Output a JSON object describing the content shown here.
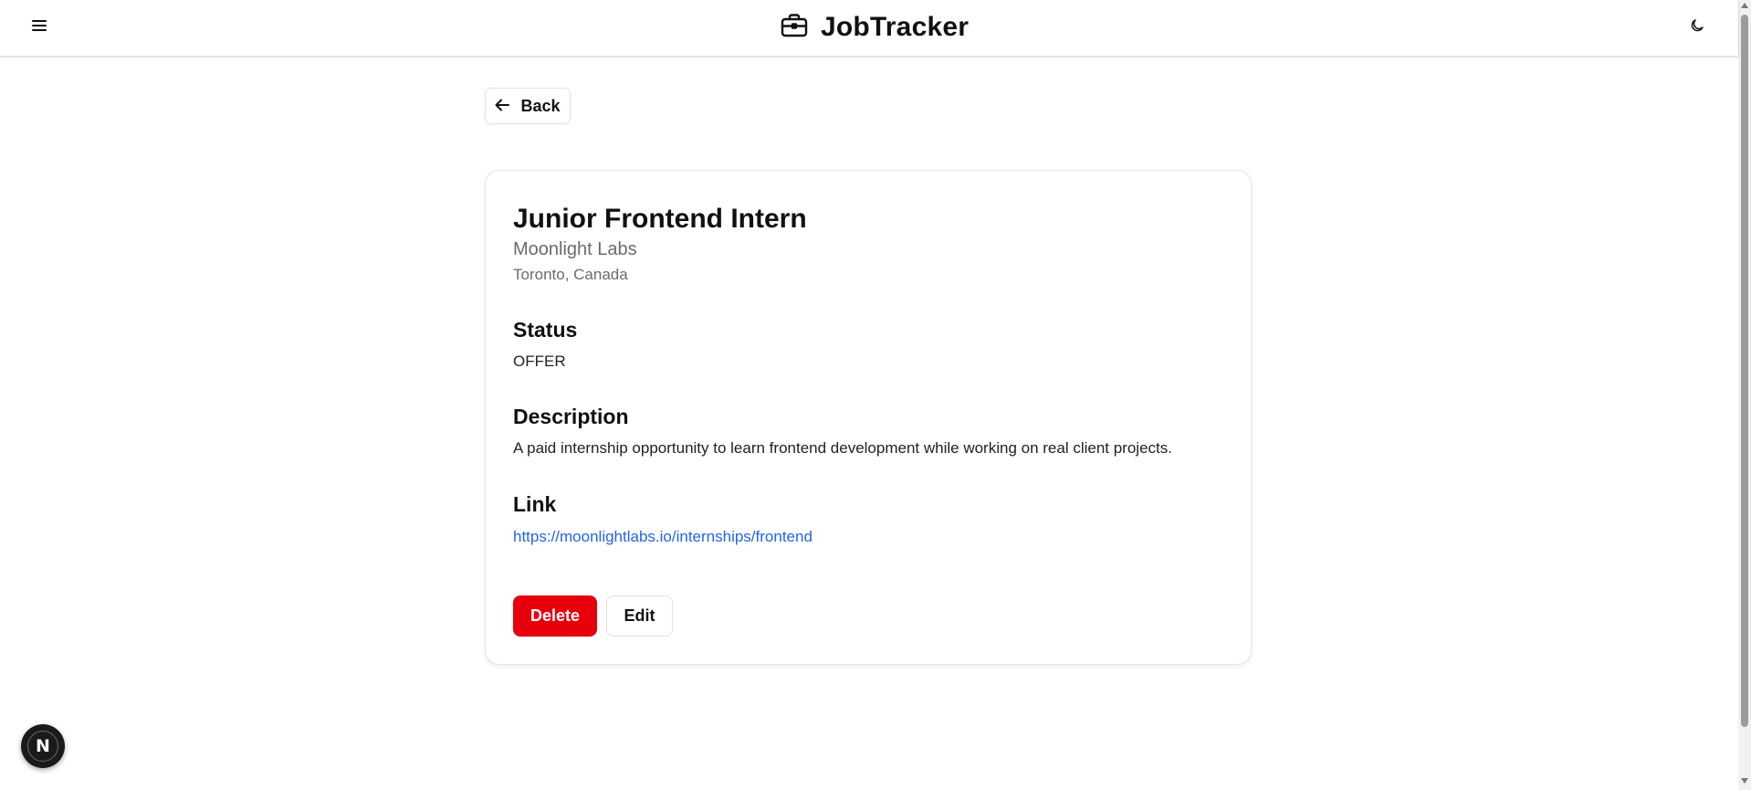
{
  "header": {
    "title": "JobTracker",
    "menu_icon": "menu-icon",
    "brand_icon": "briefcase-icon",
    "theme_icon": "moon-icon"
  },
  "back": {
    "label": "Back",
    "icon": "arrow-left-icon"
  },
  "job": {
    "title": "Junior Frontend Intern",
    "company": "Moonlight Labs",
    "location": "Toronto, Canada",
    "status_heading": "Status",
    "status_value": "OFFER",
    "description_heading": "Description",
    "description_value": "A paid internship opportunity to learn frontend development while working on real client projects.",
    "link_heading": "Link",
    "link_value": "https://moonlightlabs.io/internships/frontend"
  },
  "actions": {
    "delete_label": "Delete",
    "edit_label": "Edit"
  },
  "badge": {
    "letter": "N"
  },
  "colors": {
    "delete": "#e7000b",
    "link": "#2563eb",
    "muted": "#6b6b6b",
    "badge_bg": "#1a1a1a"
  }
}
